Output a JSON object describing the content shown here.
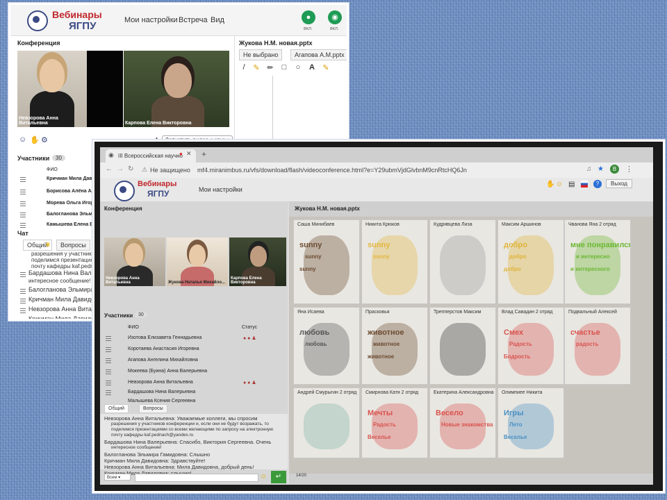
{
  "screenshot1": {
    "brand": {
      "line1": "Вебинары",
      "line2": "ЯГПУ"
    },
    "nav": [
      "Мои настройки",
      "Встреча",
      "Вид"
    ],
    "controls": [
      {
        "icon": "microphone-icon",
        "label": "вкл."
      },
      {
        "icon": "camera-icon",
        "label": "вкл."
      }
    ],
    "conference_title": "Конференция",
    "videos": [
      {
        "name": "Невзорова Анна Витальевна"
      },
      {
        "name": "Карпова Елена Викторовна"
      }
    ],
    "start_video_button": "Запустить видео и звук",
    "participants": {
      "title": "Участники",
      "count": "30",
      "header": "ФИО",
      "rows": [
        "Кричман Мила Дави",
        "Борисова Алёна Ал",
        "Морева Ольга Игор",
        "Балогланова Эльми",
        "Камышева Елена В"
      ]
    },
    "chat": {
      "title": "Чат",
      "tabs": [
        "Общий",
        "Вопросы"
      ],
      "lines": [
        "разрешения у участников",
        "поделимся презентациям",
        "почту кафедры kaf.pedna",
        "Бардашова Нина Вале",
        "интересное сообщение!",
        "Балогланова Эльмира",
        "Кричман Мила Давидо",
        "Невзорова Анна Витал",
        "Кричман Мила Давидо"
      ]
    },
    "presentation": {
      "title": "Жукова Н.М. новая.pptx",
      "tabs": [
        "Не выбрано",
        "Агапова А.М.pptx"
      ]
    }
  },
  "screenshot2": {
    "browser_tab": "III Всероссийская научно",
    "security": "Не защищено",
    "url": "mf4.miranimbus.ru/vfs/download/flash/videoconference.html?e=Y29ubmVjdGlvbnM9cnRtcHQ6Jn",
    "brand": {
      "line1": "Вебинары",
      "line2": "ЯГПУ"
    },
    "nav": [
      "Мои настройки"
    ],
    "exit_button": "Выход",
    "conference_title": "Конференция",
    "videos": [
      {
        "name": "Невзорова Анна Витальевна"
      },
      {
        "name": "Жукова Наталья Михайло..."
      },
      {
        "name": "Карпова Елена Викторовна"
      }
    ],
    "participants": {
      "title": "Участники",
      "count": "30",
      "col_name": "ФИО",
      "col_status": "Статус",
      "rows": [
        "Изотова Елизавета Геннадьевна",
        "Коротаева Анастасия Игоревна",
        "Агапова Ангелина Михайловна",
        "Мокеева (Буина) Анна Валерьевна",
        "Невзорова Анна Витальевна",
        "Бардашова Нина Валерьевна",
        "Малышева Ксения Сергеевна"
      ]
    },
    "chat": {
      "tabs": [
        "Общий",
        "Вопросы"
      ],
      "lines": [
        "Невзорова Анна Витальевна: Уважаемые коллеги, мы спросим",
        "разрешения у участников конференции и, если они не будут возражать, то",
        "поделимся презентациями со всеми желающими по запросу на электронную",
        "почту кафедры kaf.pednach@yandex.ru",
        "Бардашова Нина Валерьевна: Спасибо, Виктория Сергеевна. Очень",
        "интересное сообщение!",
        "Балогланова Эльмира Гамидовна: Слышно",
        "Кричман Мила Давидовна: Здравствуйте!",
        "Невзорова Анна Витальевна: Мила Давидовна, добрый день!",
        "Кричман Мила Давидовна: слышно!"
      ],
      "recipient": "Всем"
    },
    "presentation": {
      "title": "Жукова Н.М. новая.pptx",
      "page": "14/20"
    },
    "cards": [
      {
        "author": "Саша Минибаев",
        "words": [
          "sunny",
          "sunny",
          "sunny"
        ],
        "color": "#6b4a2f"
      },
      {
        "author": "Никита Крюков",
        "words": [
          "sunny",
          "sunny"
        ],
        "color": "#e3b640"
      },
      {
        "author": "Кудрявцева Лиза",
        "words": [],
        "color": "#9a9a9a"
      },
      {
        "author": "Максим Аршинов",
        "words": [
          "добро",
          "добро",
          "добро"
        ],
        "color": "#e0b43a"
      },
      {
        "author": "Чванова Яна 2 отряд",
        "words": [
          "мне понравился",
          "и интересно",
          "и интересного"
        ],
        "color": "#6cb832"
      },
      {
        "author": "Яна Исаева",
        "words": [
          "любовь",
          "любовь"
        ],
        "color": "#555555"
      },
      {
        "author": "Прасковья",
        "words": [
          "животное",
          "животное",
          "животное"
        ],
        "color": "#6b4a2f"
      },
      {
        "author": "Трепперстов Максим",
        "words": [],
        "color": "#333333"
      },
      {
        "author": "Влад Савадин 2 отряд",
        "words": [
          "Смех",
          "Радость",
          "Бодрость"
        ],
        "color": "#d9534f"
      },
      {
        "author": "Подвальный Алексей",
        "words": [
          "счастье",
          "радость"
        ],
        "color": "#d9534f"
      },
      {
        "author": "Андрей Смурыгин 2 отряд",
        "words": [],
        "color": "#7fb5a5"
      },
      {
        "author": "Смирнова Катя 2 отряд",
        "words": [
          "Мечты",
          "Радость",
          "Веселье"
        ],
        "color": "#d9534f"
      },
      {
        "author": "Екатерина Александровна",
        "words": [
          "Весело",
          "Новые знакомства"
        ],
        "color": "#d9534f"
      },
      {
        "author": "Олимпиее Никита",
        "words": [
          "Игры",
          "Лето",
          "Веселье"
        ],
        "color": "#4a90c2"
      }
    ]
  }
}
